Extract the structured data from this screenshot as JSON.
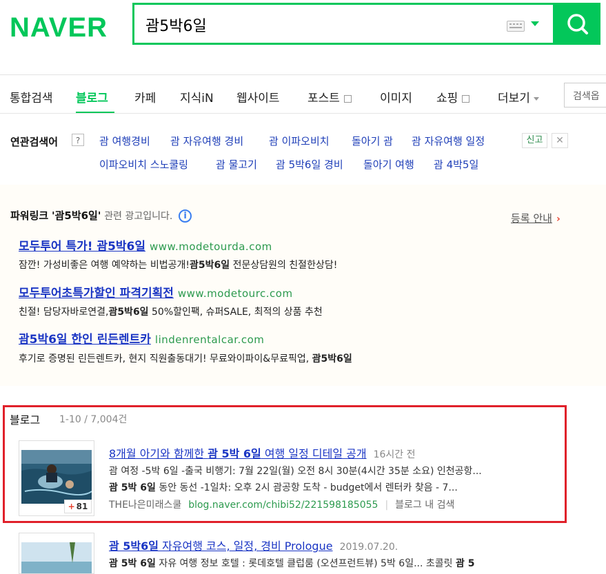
{
  "header": {
    "logo": "NAVER",
    "query": "괌5박6일"
  },
  "tabs": [
    {
      "label": "통합검색"
    },
    {
      "label": "블로그"
    },
    {
      "label": "카페"
    },
    {
      "label": "지식iN"
    },
    {
      "label": "웹사이트"
    },
    {
      "label": "포스트"
    },
    {
      "label": "이미지"
    },
    {
      "label": "쇼핑"
    },
    {
      "label": "더보기"
    }
  ],
  "search_options_label": "검색옵",
  "related": {
    "title": "연관검색어",
    "help": "?",
    "items": [
      "괌 여행경비",
      "괌 자유여행 경비",
      "괌 이파오비치",
      "돌아기 괌",
      "괌 자유여행 일정",
      "이파오비치 스노쿨링",
      "괌 물고기",
      "괌 5박6일 경비",
      "돌아기 여행",
      "괌 4박5일"
    ],
    "report": "신고",
    "close": "✕"
  },
  "powerlink": {
    "title": "파워링크",
    "query_quoted": "'괌5박6일'",
    "sub": "관련 광고입니다.",
    "info_icon": "i",
    "register": "등록 안내",
    "register_arrow": "›",
    "ads": [
      {
        "title": "모두투어 특가! 괌5박6일",
        "url": "www.modetourda.com",
        "desc_a": "잠깐! 가성비좋은 여행 예약하는 비법공개!",
        "desc_b": "괌5박6일",
        "desc_c": " 전문상담원의 친절한상담!"
      },
      {
        "title": "모두투어초특가할인 파격기획전",
        "url": "www.modetourc.com",
        "desc_a": "친절! 담당자바로연결,",
        "desc_b": "괌5박6일",
        "desc_c": " 50%할인팩, 슈퍼SALE, 최적의 상품 추천"
      },
      {
        "title": "괌5박6일 한인 린든렌트카",
        "url": "lindenrentalcar.com",
        "desc_a": "후기로 증명된 린든렌트카, 현지 직원출동대기! 무료와이파이&무료픽업,",
        "desc_b": "괌5박6일",
        "desc_c": ""
      }
    ]
  },
  "blog": {
    "heading": "블로그",
    "count": "1-10 / 7,004건",
    "posts": [
      {
        "title_a": "8개월 아기와 함께한 ",
        "title_b": "괌 5박 6일",
        "title_c": " 여행 일정 디테일 공개",
        "time": "16시간 전",
        "l1_a": "괌",
        "l1_b": " 여정 -5박 6일 -출국 비행기: 7월 22일(월) 오전 8시 30분(4시간 35분 소요) 인천공항...",
        "l2_a": "괌 5박 6일",
        "l2_b": " 동안 동선 -1일차: 오후 2시 괌공항 도착 - budget에서 렌터카 찾음 - 7...",
        "author": "THE나은미래스쿨",
        "url": "blog.naver.com/chibi52/221598185055",
        "inner_search": "블로그 내 검색",
        "badge_plus": "+",
        "badge": "81"
      },
      {
        "title_a": "",
        "title_b": "괌 5박6일",
        "title_c": " 자유여행 코스, 일정, 경비 Prologue",
        "time": "2019.07.20.",
        "l1_a": "괌 5박 6일",
        "l1_b": " 자유 여행 정보 호텔 : 롯데호텔 클럽룸 (오션프런트뷰) 5박 6일... 초콜릿 ",
        "l1_c": "괌 5"
      }
    ]
  },
  "colors": {
    "brand": "#03c75a",
    "link": "#1a35c4",
    "url": "#2c9a4e",
    "highlight_border": "#e0202a"
  }
}
